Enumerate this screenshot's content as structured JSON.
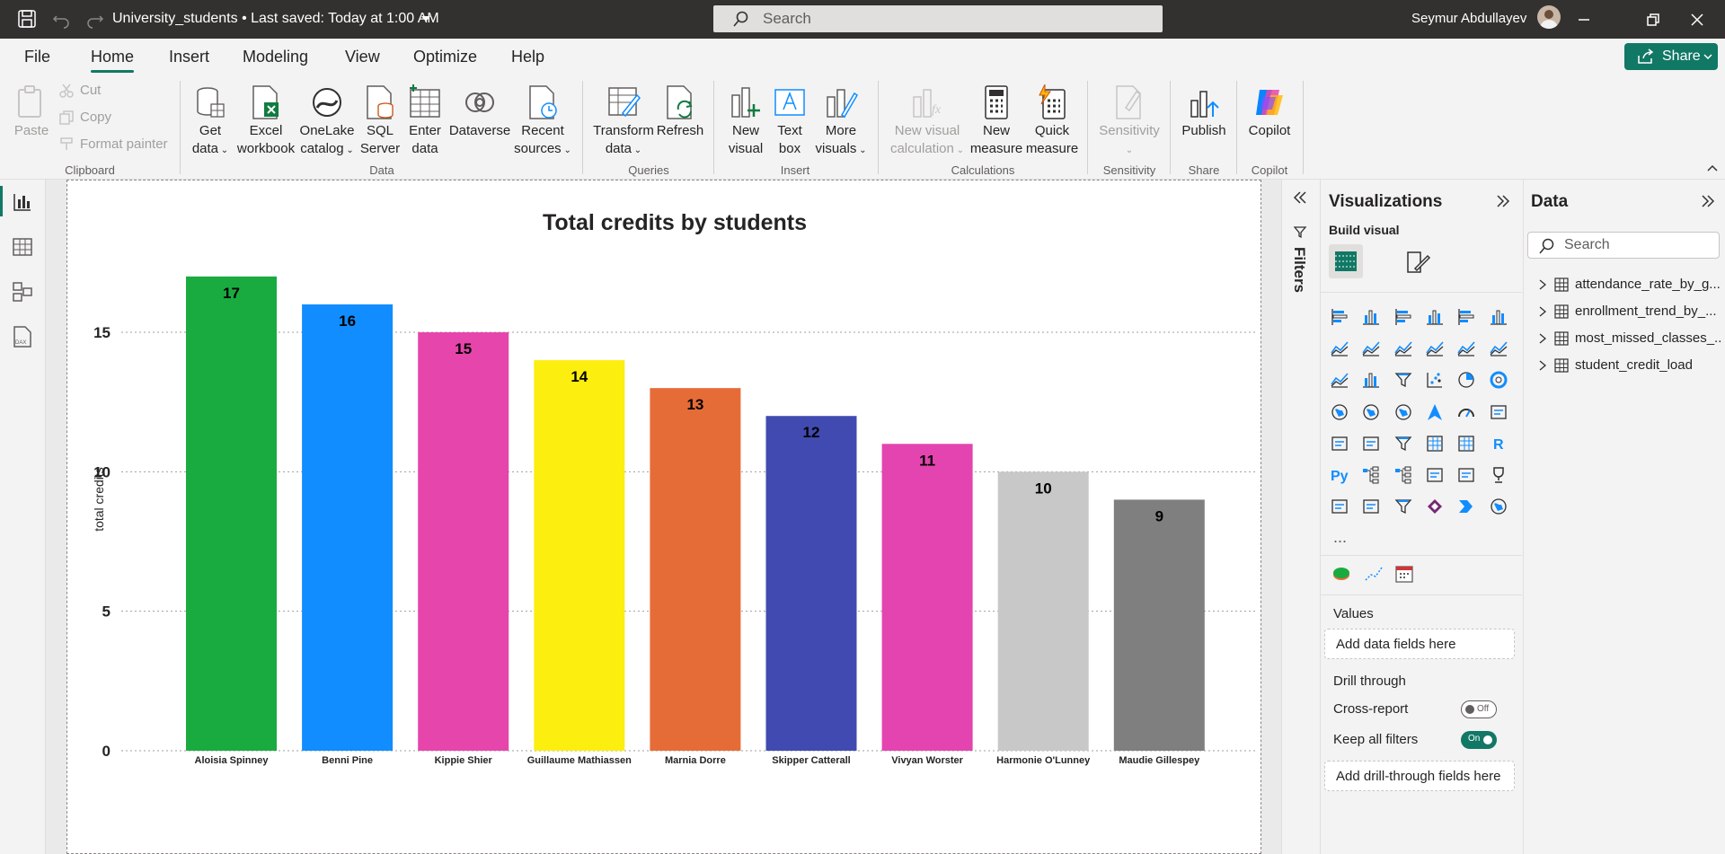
{
  "titlebar": {
    "doc_title": "University_students • Last saved: Today at 1:00 AM",
    "search_placeholder": "Search",
    "user_name": "Seymur Abdullayev"
  },
  "menu": {
    "items": [
      "File",
      "Home",
      "Insert",
      "Modeling",
      "View",
      "Optimize",
      "Help"
    ],
    "active": "Home",
    "share_label": "Share"
  },
  "ribbon": {
    "clipboard": {
      "paste": "Paste",
      "cut": "Cut",
      "copy": "Copy",
      "format_painter": "Format painter",
      "group": "Clipboard"
    },
    "data": {
      "get_data": [
        "Get",
        "data"
      ],
      "excel": [
        "Excel",
        "workbook"
      ],
      "onelake": [
        "OneLake",
        "catalog"
      ],
      "sql": [
        "SQL",
        "Server"
      ],
      "enter": [
        "Enter",
        "data"
      ],
      "dataverse": "Dataverse",
      "recent": [
        "Recent",
        "sources"
      ],
      "group": "Data"
    },
    "queries": {
      "transform": [
        "Transform",
        "data"
      ],
      "refresh": "Refresh",
      "group": "Queries"
    },
    "insert": {
      "new_visual": [
        "New",
        "visual"
      ],
      "text_box": [
        "Text",
        "box"
      ],
      "more_visuals": [
        "More",
        "visuals"
      ],
      "group": "Insert"
    },
    "calculations": {
      "new_visual_calc": [
        "New visual",
        "calculation"
      ],
      "new_measure": [
        "New",
        "measure"
      ],
      "quick_measure": [
        "Quick",
        "measure"
      ],
      "group": "Calculations"
    },
    "sensitivity": {
      "label": "Sensitivity",
      "group": "Sensitivity"
    },
    "share": {
      "publish": "Publish",
      "group": "Share"
    },
    "copilot": {
      "label": "Copilot",
      "group": "Copilot"
    }
  },
  "chart_data": {
    "type": "bar",
    "title": "Total credits by students",
    "xlabel": "",
    "ylabel": "total credits",
    "ylim": [
      0,
      18
    ],
    "yticks": [
      0,
      5,
      10,
      15
    ],
    "grid": true,
    "categories": [
      "Aloisia Spinney",
      "Benni Pine",
      "Kippie Shier",
      "Guillaume Mathiassen",
      "Marnia Dorre",
      "Skipper Catterall",
      "Vivyan Worster",
      "Harmonie O'Lunney",
      "Maudie Gillespey"
    ],
    "values": [
      17,
      16,
      15,
      14,
      13,
      12,
      11,
      10,
      9
    ],
    "colors": [
      "#1aab40",
      "#118dff",
      "#e645ab",
      "#fcee0f",
      "#e66c37",
      "#404ab0",
      "#e344af",
      "#c8c8c8",
      "#7f7f7f"
    ]
  },
  "filters": {
    "label": "Filters"
  },
  "visualizations": {
    "title": "Visualizations",
    "build_visual": "Build visual",
    "more": "...",
    "values_label": "Values",
    "values_placeholder": "Add data fields here",
    "drill_through": "Drill through",
    "cross_report": "Cross-report",
    "cross_report_state": "Off",
    "keep_filters": "Keep all filters",
    "keep_filters_state": "On",
    "drill_placeholder": "Add drill-through fields here"
  },
  "data_pane": {
    "title": "Data",
    "search_placeholder": "Search",
    "tables": [
      "attendance_rate_by_g...",
      "enrollment_trend_by_...",
      "most_missed_classes_...",
      "student_credit_load"
    ]
  }
}
